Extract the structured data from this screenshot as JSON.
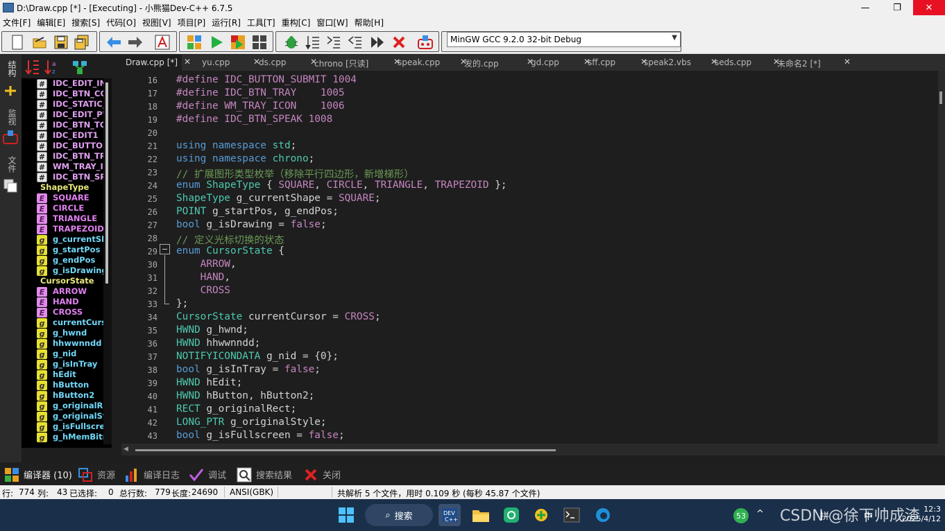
{
  "window": {
    "title": "D:\\Draw.cpp [*] - [Executing] - 小熊猫Dev-C++ 6.7.5",
    "controls": {
      "minimize": "—",
      "restore": "❐",
      "close": "✕"
    }
  },
  "menu": [
    "文件[F]",
    "编辑[E]",
    "搜索[S]",
    "代码[O]",
    "视图[V]",
    "项目[P]",
    "运行[R]",
    "工具[T]",
    "重构[C]",
    "窗口[W]",
    "帮助[H]"
  ],
  "toolbar": {
    "compiler": "MinGW GCC 9.2.0 32-bit Debug",
    "icons": [
      "new-file-icon",
      "open-file-icon",
      "save-icon",
      "save-all-icon",
      "back-icon",
      "forward-icon",
      "format-icon",
      "compile-icon",
      "run-icon",
      "compile-run-icon",
      "rebuild-icon",
      "debug-icon",
      "step-icon",
      "step-into-icon",
      "step-out-icon",
      "continue-icon",
      "stop-icon",
      "cpu-window-icon"
    ]
  },
  "side_tabs": {
    "structure": "结构",
    "files": "文件",
    "bookmarks": "监视"
  },
  "class_browser": {
    "items": [
      {
        "kind": "define",
        "icon": "#",
        "label": "IDC_EDIT_INP"
      },
      {
        "kind": "define",
        "icon": "#",
        "label": "IDC_BTN_COL"
      },
      {
        "kind": "define",
        "icon": "#",
        "label": "IDC_STATIC_T"
      },
      {
        "kind": "define",
        "icon": "#",
        "label": "IDC_EDIT_PW"
      },
      {
        "kind": "define",
        "icon": "#",
        "label": "IDC_BTN_TOG"
      },
      {
        "kind": "define",
        "icon": "#",
        "label": "IDC_EDIT1"
      },
      {
        "kind": "define",
        "icon": "#",
        "label": "IDC_BUTTON"
      },
      {
        "kind": "define",
        "icon": "#",
        "label": "IDC_BTN_TRA"
      },
      {
        "kind": "define",
        "icon": "#",
        "label": "WM_TRAY_IC"
      },
      {
        "kind": "define",
        "icon": "#",
        "label": "IDC_BTN_SPE"
      },
      {
        "kind": "group",
        "icon": "",
        "label": "ShapeType"
      },
      {
        "kind": "enumv",
        "icon": "E",
        "label": "SQUARE"
      },
      {
        "kind": "enumv",
        "icon": "E",
        "label": "CIRCLE"
      },
      {
        "kind": "enumv",
        "icon": "E",
        "label": "TRIANGLE"
      },
      {
        "kind": "enumv",
        "icon": "E",
        "label": "TRAPEZOID"
      },
      {
        "kind": "glob",
        "icon": "g",
        "label": "g_currentSha"
      },
      {
        "kind": "glob",
        "icon": "g",
        "label": "g_startPos"
      },
      {
        "kind": "glob",
        "icon": "g",
        "label": "g_endPos"
      },
      {
        "kind": "glob",
        "icon": "g",
        "label": "g_isDrawing"
      },
      {
        "kind": "group",
        "icon": "",
        "label": "CursorState"
      },
      {
        "kind": "enumv",
        "icon": "E",
        "label": "ARROW"
      },
      {
        "kind": "enumv",
        "icon": "E",
        "label": "HAND"
      },
      {
        "kind": "enumv",
        "icon": "E",
        "label": "CROSS"
      },
      {
        "kind": "glob",
        "icon": "g",
        "label": "currentCurso"
      },
      {
        "kind": "glob",
        "icon": "g",
        "label": "g_hwnd"
      },
      {
        "kind": "glob",
        "icon": "g",
        "label": "hhwwnndd"
      },
      {
        "kind": "glob",
        "icon": "g",
        "label": "g_nid"
      },
      {
        "kind": "glob",
        "icon": "g",
        "label": "g_isInTray"
      },
      {
        "kind": "glob",
        "icon": "g",
        "label": "hEdit"
      },
      {
        "kind": "glob",
        "icon": "g",
        "label": "hButton"
      },
      {
        "kind": "glob",
        "icon": "g",
        "label": "hButton2"
      },
      {
        "kind": "glob",
        "icon": "g",
        "label": "g_originalRec"
      },
      {
        "kind": "glob",
        "icon": "g",
        "label": "g_originalStyl"
      },
      {
        "kind": "glob",
        "icon": "g",
        "label": "g_isFullscreen"
      },
      {
        "kind": "glob",
        "icon": "g",
        "label": "g_hMemBitm"
      }
    ]
  },
  "tabs": [
    {
      "label": "Draw.cpp [*]",
      "active": true
    },
    {
      "label": "yu.cpp",
      "active": false
    },
    {
      "label": "ds.cpp",
      "active": false
    },
    {
      "label": "chrono [只读]",
      "active": false
    },
    {
      "label": "speak.cpp",
      "active": false
    },
    {
      "label": "发的.cpp",
      "active": false
    },
    {
      "label": "gd.cpp",
      "active": false
    },
    {
      "label": "sff.cpp",
      "active": false
    },
    {
      "label": "speak2.vbs",
      "active": false
    },
    {
      "label": "seds.cpp",
      "active": false
    },
    {
      "label": "未命名2 [*]",
      "active": false
    }
  ],
  "editor": {
    "lines": [
      {
        "n": "16",
        "tokens": [
          [
            "mac",
            "#define IDC_BUTTON_SUBMIT 1004"
          ]
        ]
      },
      {
        "n": "17",
        "tokens": [
          [
            "mac",
            "#define IDC_BTN_TRAY    1005"
          ]
        ]
      },
      {
        "n": "18",
        "tokens": [
          [
            "mac",
            "#define WM_TRAY_ICON    1006"
          ]
        ]
      },
      {
        "n": "19",
        "tokens": [
          [
            "mac",
            "#define IDC_BTN_SPEAK 1008"
          ]
        ]
      },
      {
        "n": "20",
        "tokens": []
      },
      {
        "n": "21",
        "tokens": [
          [
            "blue",
            "using namespace "
          ],
          [
            "ty",
            "std"
          ],
          [
            "id",
            ";"
          ]
        ]
      },
      {
        "n": "22",
        "tokens": [
          [
            "blue",
            "using namespace "
          ],
          [
            "ty",
            "chrono"
          ],
          [
            "id",
            ";"
          ]
        ]
      },
      {
        "n": "23",
        "tokens": [
          [
            "cmt",
            "// 扩展图形类型枚举（移除平行四边形，新增梯形）"
          ]
        ]
      },
      {
        "n": "24",
        "tokens": [
          [
            "blue",
            "enum "
          ],
          [
            "ty",
            "ShapeType"
          ],
          [
            "id",
            " { "
          ],
          [
            "con",
            "SQUARE"
          ],
          [
            "id",
            ", "
          ],
          [
            "con",
            "CIRCLE"
          ],
          [
            "id",
            ", "
          ],
          [
            "con",
            "TRIANGLE"
          ],
          [
            "id",
            ", "
          ],
          [
            "con",
            "TRAPEZOID"
          ],
          [
            "id",
            " };"
          ]
        ]
      },
      {
        "n": "25",
        "tokens": [
          [
            "ty",
            "ShapeType"
          ],
          [
            "id",
            " g_currentShape = "
          ],
          [
            "con",
            "SQUARE"
          ],
          [
            "id",
            ";"
          ]
        ]
      },
      {
        "n": "26",
        "tokens": [
          [
            "ty",
            "POINT"
          ],
          [
            "id",
            " g_startPos, g_endPos;"
          ]
        ]
      },
      {
        "n": "27",
        "tokens": [
          [
            "blue",
            "bool"
          ],
          [
            "id",
            " g_isDrawing = "
          ],
          [
            "con",
            "false"
          ],
          [
            "id",
            ";"
          ]
        ]
      },
      {
        "n": "28",
        "tokens": [
          [
            "cmt",
            "// 定义光标切换的状态"
          ]
        ]
      },
      {
        "n": "29",
        "tokens": [
          [
            "blue",
            "enum "
          ],
          [
            "ty",
            "CursorState"
          ],
          [
            "id",
            " {"
          ]
        ]
      },
      {
        "n": "30",
        "tokens": [
          [
            "con",
            "    ARROW"
          ],
          [
            "id",
            ","
          ]
        ]
      },
      {
        "n": "31",
        "tokens": [
          [
            "con",
            "    HAND"
          ],
          [
            "id",
            ","
          ]
        ]
      },
      {
        "n": "32",
        "tokens": [
          [
            "con",
            "    CROSS"
          ]
        ]
      },
      {
        "n": "33",
        "tokens": [
          [
            "id",
            "};"
          ]
        ]
      },
      {
        "n": "34",
        "tokens": [
          [
            "ty",
            "CursorState"
          ],
          [
            "id",
            " currentCursor = "
          ],
          [
            "con",
            "CROSS"
          ],
          [
            "id",
            ";"
          ]
        ]
      },
      {
        "n": "35",
        "tokens": [
          [
            "ty",
            "HWND"
          ],
          [
            "id",
            " g_hwnd;"
          ]
        ]
      },
      {
        "n": "36",
        "tokens": [
          [
            "ty",
            "HWND"
          ],
          [
            "id",
            " hhwwnndd;"
          ]
        ]
      },
      {
        "n": "37",
        "tokens": [
          [
            "ty",
            "NOTIFYICONDATA"
          ],
          [
            "id",
            " g_nid = {0};"
          ]
        ]
      },
      {
        "n": "38",
        "tokens": [
          [
            "blue",
            "bool"
          ],
          [
            "id",
            " g_isInTray = "
          ],
          [
            "con",
            "false"
          ],
          [
            "id",
            ";"
          ]
        ]
      },
      {
        "n": "39",
        "tokens": [
          [
            "ty",
            "HWND"
          ],
          [
            "id",
            " hEdit;"
          ]
        ]
      },
      {
        "n": "40",
        "tokens": [
          [
            "ty",
            "HWND"
          ],
          [
            "id",
            " hButton, hButton2;"
          ]
        ]
      },
      {
        "n": "41",
        "tokens": [
          [
            "ty",
            "RECT"
          ],
          [
            "id",
            " g_originalRect;"
          ]
        ]
      },
      {
        "n": "42",
        "tokens": [
          [
            "ty",
            "LONG_PTR"
          ],
          [
            "id",
            " g_originalStyle;"
          ]
        ]
      },
      {
        "n": "43",
        "tokens": [
          [
            "blue",
            "bool"
          ],
          [
            "id",
            " g_isFullscreen = "
          ],
          [
            "con",
            "false"
          ],
          [
            "id",
            ";"
          ]
        ]
      }
    ]
  },
  "bottom_tabs": [
    {
      "label": "编译器 (10)",
      "icon": "compiler-icon",
      "active": true
    },
    {
      "label": "资源",
      "icon": "resources-icon",
      "active": false
    },
    {
      "label": "编译日志",
      "icon": "compile-log-icon",
      "active": false
    },
    {
      "label": "调试",
      "icon": "debug-check-icon",
      "active": false
    },
    {
      "label": "搜索结果",
      "icon": "search-results-icon",
      "active": false
    },
    {
      "label": "关闭",
      "icon": "close-red-icon",
      "active": false
    }
  ],
  "status": {
    "row_label": "行:",
    "row": "774",
    "col_label": "列:",
    "col": "43",
    "sel_label": "已选择:",
    "sel": "0",
    "total_label": "总行数:",
    "total": "779",
    "len_label": "长度:",
    "len": "24690",
    "encoding": "ANSI(GBK)",
    "message": "共解析 5 个文件，用时 0.109 秒 (每秒 45.87 个文件)"
  },
  "taskbar": {
    "search": "搜索",
    "tray_badge": "53",
    "ime": "拼",
    "lang": "中",
    "time": "12:3",
    "date": "2025/4/12",
    "watermark": "CSDN @徐下帅成渣"
  }
}
